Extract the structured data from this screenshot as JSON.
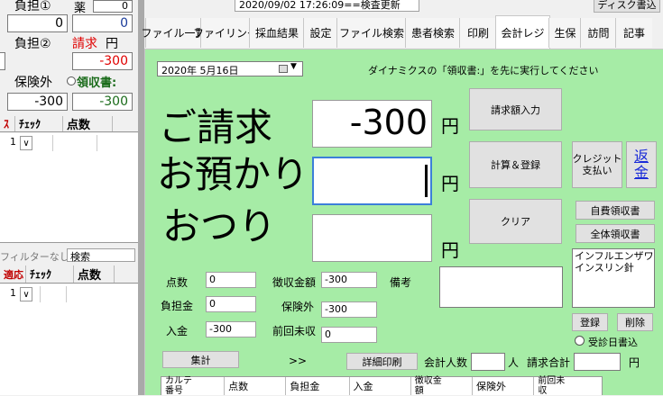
{
  "left": {
    "burden1_label": "負担①",
    "drug_label": "薬",
    "drug_value": "0",
    "burden1_value": "0",
    "burden1_value2": "0",
    "burden2_label": "負担②",
    "bill_label": "請求",
    "yen": "円",
    "bill_value": "-300",
    "outside_label": "保険外",
    "receipt_label": "領収書:",
    "outside_value": "-300",
    "receipt_value": "-300",
    "table1_headers": [
      "ｽ",
      "ﾁｪｯｸ",
      "点数"
    ],
    "table1_row_value": "1",
    "filter_label": "フィルターなし",
    "search_label": "検索",
    "table2_headers": [
      "適応",
      "ﾁｪｯｸ",
      "点数"
    ],
    "table2_row_value": "1"
  },
  "top": {
    "datetime_status": "2020/09/02 17:26:09==検査更新",
    "disk_write": "ディスク書込"
  },
  "tabs": [
    "ファイル一覧",
    "ファイリング",
    "採血結果",
    "設定",
    "ファイル検索",
    "患者検索",
    "印刷",
    "会計レジ",
    "生保",
    "訪問",
    "記事"
  ],
  "active_tab": "会計レジ",
  "register": {
    "date_value": "2020年  5月16日",
    "notice": "ダイナミクスの「領収書:」を先に実行してください",
    "bill_big_label": "ご請求",
    "deposit_big_label": "お預かり",
    "change_big_label": "おつり",
    "bill_amount": "-300",
    "deposit_amount": "",
    "change_amount": "",
    "yen": "円",
    "btn_bill_input": "請求額入力",
    "btn_calc_register": "計算＆登録",
    "btn_credit": "クレジット\n支払い",
    "btn_refund": "返金",
    "btn_clear": "クリア",
    "btn_self_receipt": "自費領収書",
    "btn_all_receipt": "全体領収書",
    "memo_text": "インフルエンザワクチ\nインスリン針",
    "btn_register": "登録",
    "btn_delete": "削除",
    "radio_visit_date": "受診日書込",
    "points_label": "点数",
    "points_value": "0",
    "burden_label": "負担金",
    "burden_value": "0",
    "payment_label": "入金",
    "payment_value": "-300",
    "collected_label": "徴収金額",
    "collected_value": "-300",
    "outside_label": "保険外",
    "outside_value": "-300",
    "prev_unpaid_label": "前回未収",
    "prev_unpaid_value": "0",
    "remarks_label": "備考",
    "btn_total": "集計",
    "arrows": ">>",
    "btn_detail_print": "詳細印刷",
    "count_label": "会計人数",
    "count_unit": "人",
    "total_label": "請求合計",
    "total_unit": "円",
    "grid_headers": [
      "カルテ\n番号",
      "点数",
      "負担金",
      "入金",
      "徴収金\n額",
      "保険外",
      "前回未\n収"
    ]
  }
}
